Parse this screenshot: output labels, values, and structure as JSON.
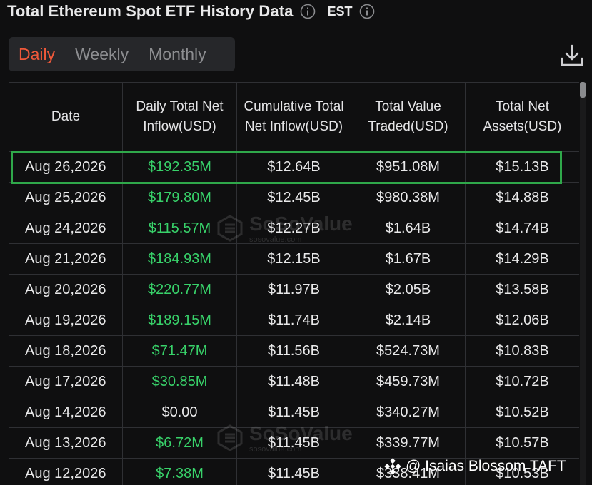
{
  "header": {
    "title": "Total Ethereum Spot ETF History Data",
    "timezone": "EST"
  },
  "tabs": [
    {
      "label": "Daily",
      "active": true
    },
    {
      "label": "Weekly",
      "active": false
    },
    {
      "label": "Monthly",
      "active": false
    }
  ],
  "table": {
    "columns": [
      "Daily Total Net Inflow(USD)",
      "Cumulative Total Net Inflow(USD)",
      "Total Value Traded(USD)",
      "Total Net Assets(USD)"
    ],
    "date_header": "Date",
    "rows": [
      {
        "date": "Aug 26,2026",
        "daily": "$192.35M",
        "cumulative": "$12.64B",
        "traded": "$951.08M",
        "assets": "$15.13B",
        "highlight": true
      },
      {
        "date": "Aug 25,2026",
        "daily": "$179.80M",
        "cumulative": "$12.45B",
        "traded": "$980.38M",
        "assets": "$14.88B"
      },
      {
        "date": "Aug 24,2026",
        "daily": "$115.57M",
        "cumulative": "$12.27B",
        "traded": "$1.64B",
        "assets": "$14.74B"
      },
      {
        "date": "Aug 21,2026",
        "daily": "$184.93M",
        "cumulative": "$12.15B",
        "traded": "$1.67B",
        "assets": "$14.29B"
      },
      {
        "date": "Aug 20,2026",
        "daily": "$220.77M",
        "cumulative": "$11.97B",
        "traded": "$2.05B",
        "assets": "$13.58B"
      },
      {
        "date": "Aug 19,2026",
        "daily": "$189.15M",
        "cumulative": "$11.74B",
        "traded": "$2.14B",
        "assets": "$12.06B"
      },
      {
        "date": "Aug 18,2026",
        "daily": "$71.47M",
        "cumulative": "$11.56B",
        "traded": "$524.73M",
        "assets": "$10.83B"
      },
      {
        "date": "Aug 17,2026",
        "daily": "$30.85M",
        "cumulative": "$11.48B",
        "traded": "$459.73M",
        "assets": "$10.72B"
      },
      {
        "date": "Aug 14,2026",
        "daily": "$0.00",
        "cumulative": "$11.45B",
        "traded": "$340.27M",
        "assets": "$10.52B",
        "neutral": true
      },
      {
        "date": "Aug 13,2026",
        "daily": "$6.72M",
        "cumulative": "$11.45B",
        "traded": "$339.77M",
        "assets": "$10.57B"
      },
      {
        "date": "Aug 12,2026",
        "daily": "$7.38M",
        "cumulative": "$11.45B",
        "traded": "$338.41M",
        "assets": "$10.53B"
      }
    ]
  },
  "watermark": {
    "brand": "SoSoValue",
    "site": "sosovalue.com"
  },
  "credit": {
    "text": "@ Isaias Blossom TAFT"
  },
  "colors": {
    "accent": "#f0593a",
    "positive": "#38d26a",
    "highlight_border": "#2fa84a",
    "background": "#0f0f10"
  },
  "icons": {
    "info": "info-circle-icon",
    "download": "download-icon",
    "credit": "binance-logo-icon"
  }
}
